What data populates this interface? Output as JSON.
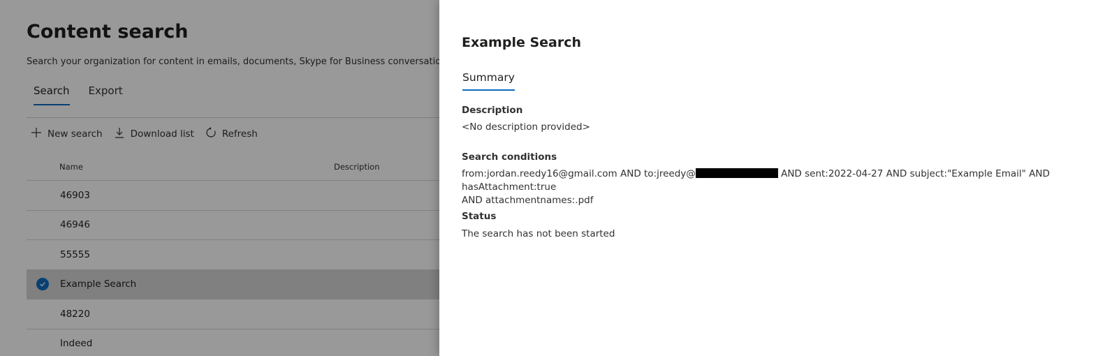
{
  "page": {
    "title": "Content search",
    "description": "Search your organization for content in emails, documents, Skype for Business conversations, an",
    "tabs": [
      {
        "label": "Search",
        "active": true
      },
      {
        "label": "Export",
        "active": false
      }
    ],
    "toolbar": {
      "new_search": "New search",
      "download_list": "Download list",
      "refresh": "Refresh"
    },
    "columns": {
      "name": "Name",
      "description": "Description"
    },
    "rows": [
      {
        "name": "46903"
      },
      {
        "name": "46946"
      },
      {
        "name": "55555"
      },
      {
        "name": "Example Search",
        "selected": true
      },
      {
        "name": "48220"
      },
      {
        "name": "Indeed"
      }
    ]
  },
  "panel": {
    "title": "Example Search",
    "tab": "Summary",
    "description_label": "Description",
    "description_value": "<No description provided>",
    "conditions_label": "Search conditions",
    "conditions_part1": "from:jordan.reedy16@gmail.com AND to:jreedy@",
    "conditions_part2": " AND sent:2022-04-27 AND subject:\"Example Email\" AND hasAttachment:true",
    "conditions_line2": "AND attachmentnames:.pdf",
    "status_label": "Status",
    "status_value": "The search has not been started"
  },
  "colors": {
    "accent": "#0f6cbd",
    "overlay": "rgba(0,0,0,0.4)"
  },
  "icons": [
    "plus-icon",
    "download-icon",
    "refresh-icon",
    "checkmark-icon"
  ]
}
